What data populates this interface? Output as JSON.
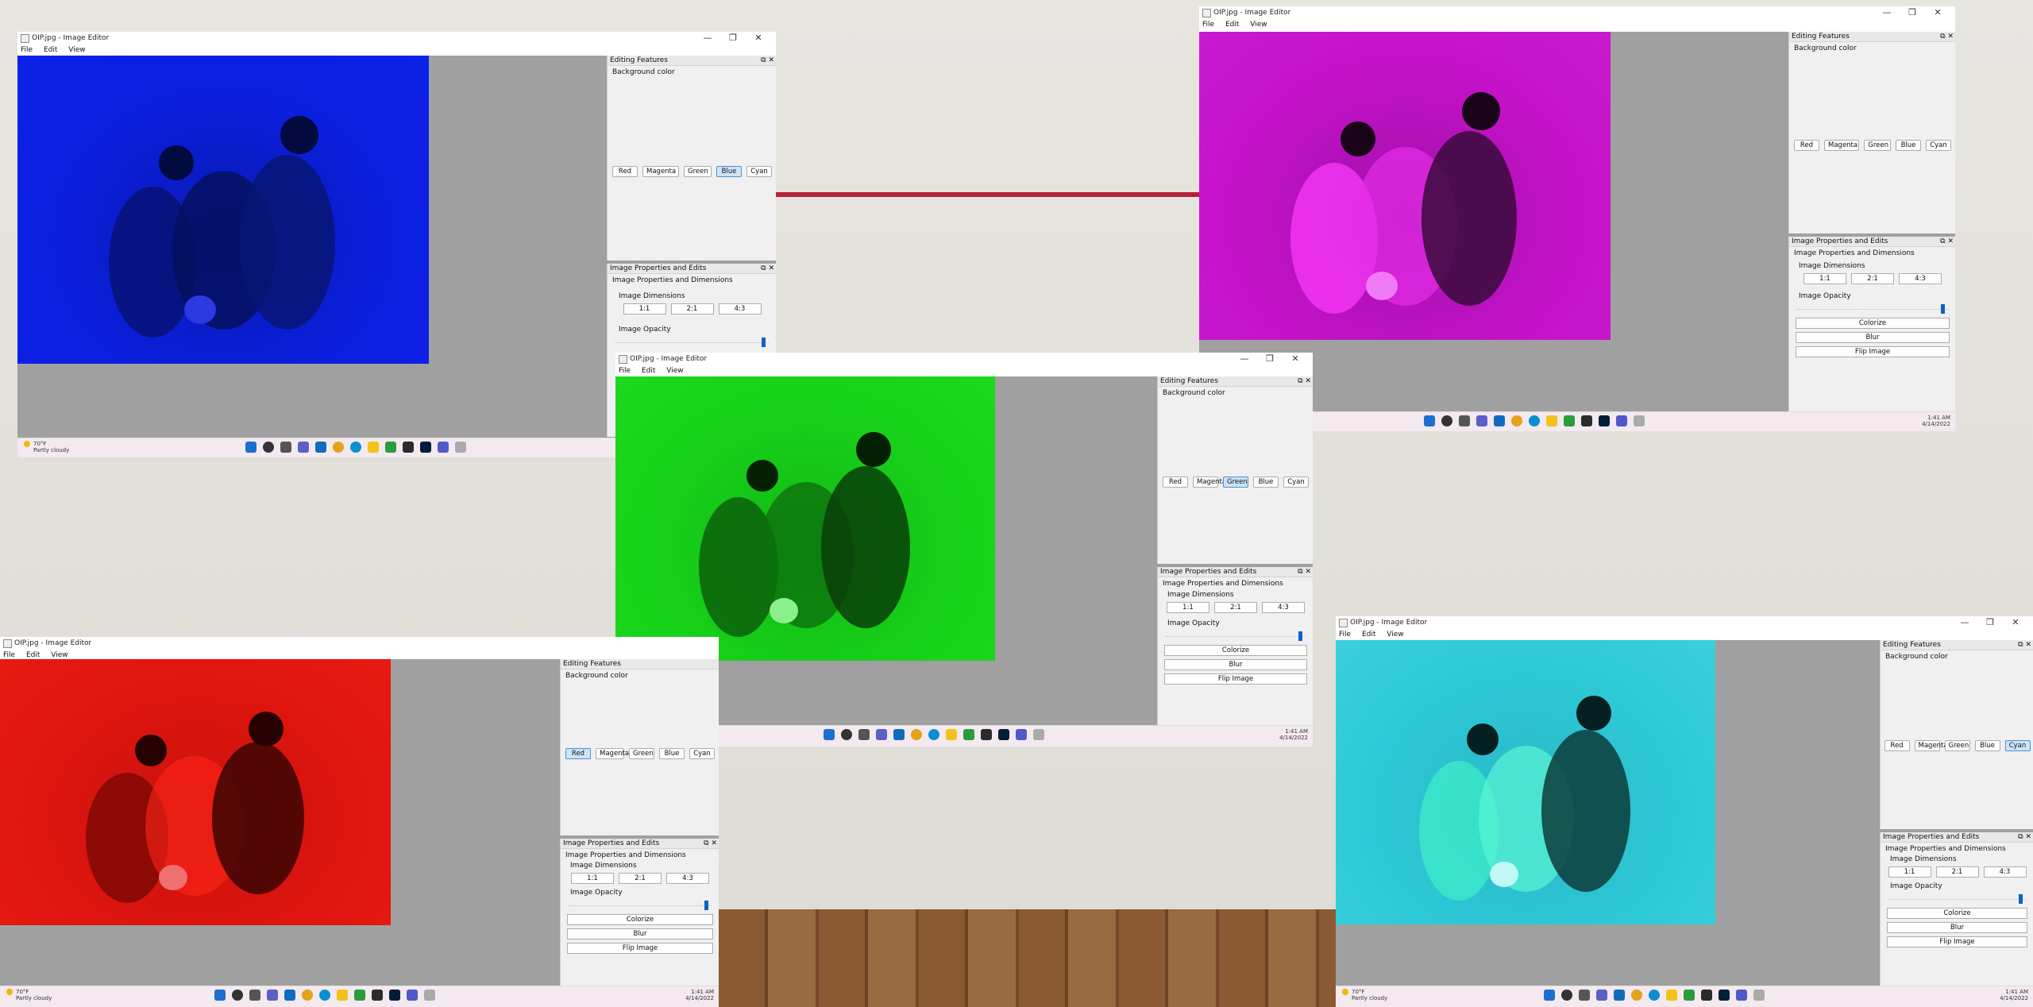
{
  "window_title": "OIP.jpg - Image Editor",
  "menu": {
    "file": "File",
    "edit": "Edit",
    "view": "View"
  },
  "win_controls": {
    "minimize": "—",
    "maximize": "❐",
    "close": "✕"
  },
  "editing_panel": {
    "title": "Editing Features",
    "bg_label": "Background color",
    "colors": {
      "red": "Red",
      "magenta": "Magenta",
      "green": "Green",
      "blue": "Blue",
      "cyan": "Cyan"
    }
  },
  "props_panel": {
    "title": "Image Properties and Edits",
    "subtitle": "Image Properties and Dimensions",
    "dims_label": "Image Dimensions",
    "dims": {
      "r11": "1:1",
      "r21": "2:1",
      "r43": "4:3"
    },
    "opacity_label": "Image Opacity",
    "colorize": "Colorize",
    "blur": "Blur",
    "flip": "Flip Image"
  },
  "taskbar": {
    "temp": "70°F",
    "weather": "Partly cloudy",
    "time": "1:41 AM",
    "date": "4/14/2022"
  },
  "tint_colors": {
    "blue": "#0a1fe0",
    "magenta": "#c512c9",
    "green": "#18d21a",
    "red": "#e0150f",
    "cyan": "#2ec9d6"
  }
}
